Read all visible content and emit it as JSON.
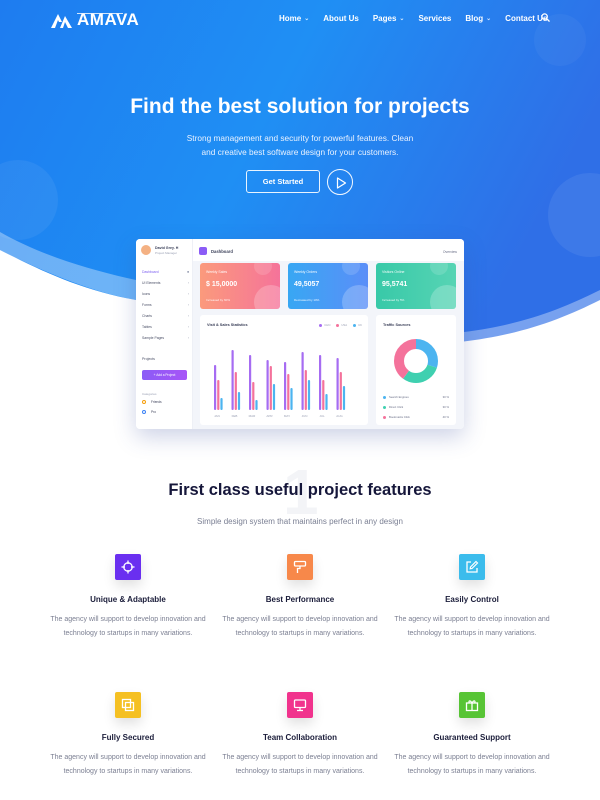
{
  "brand": {
    "name": "AMAVA"
  },
  "nav": {
    "items": [
      {
        "label": "Home",
        "caret": true
      },
      {
        "label": "About Us",
        "caret": false
      },
      {
        "label": "Pages",
        "caret": true
      },
      {
        "label": "Services",
        "caret": false
      },
      {
        "label": "Blog",
        "caret": true
      },
      {
        "label": "Contact Us",
        "caret": false
      }
    ],
    "search_icon": "search-icon"
  },
  "hero": {
    "title": "Find the best solution for projects",
    "subtitle": "Strong management and security for powerful features. Clean and creative best software design for your customers.",
    "cta_label": "Get Started",
    "play_icon": "play-icon"
  },
  "dashboard": {
    "user_name": "David Grey. H",
    "user_role": "Project Manager",
    "menu": [
      "Dashboard",
      "UI Elements",
      "Icons",
      "Forms",
      "Charts",
      "Tables",
      "Sample Pages"
    ],
    "projects_label": "Projects",
    "add_project_label": "+ Add a Project",
    "groups_label": "Categories",
    "options": [
      "Friends",
      "Pro"
    ],
    "header_title": "Dashboard",
    "overview_label": "Overview",
    "cards": [
      {
        "label": "Weekly Sales",
        "value": "$ 15,0000",
        "footer": "Increased by 60%"
      },
      {
        "label": "Weekly Orders",
        "value": "49,5057",
        "footer": "Decreased by 10%"
      },
      {
        "label": "Visitors Online",
        "value": "95,5741",
        "footer": "Increased by 5%"
      }
    ],
    "chart_title": "Visit & Sales Statistics",
    "chart_legend": [
      "CHN",
      "USA",
      "UK"
    ],
    "chart_months": [
      "JAN",
      "FEB",
      "MAR",
      "APR",
      "MAY",
      "JUN",
      "JUL",
      "AUG"
    ],
    "chart_series": [
      [
        45,
        60,
        55,
        50,
        48,
        58,
        55,
        52
      ],
      [
        30,
        38,
        28,
        44,
        36,
        40,
        30,
        38
      ],
      [
        12,
        18,
        10,
        26,
        22,
        30,
        16,
        24
      ]
    ],
    "traffic_title": "Traffic Sources",
    "traffic": [
      {
        "label": "Search Engines",
        "value": "30 %"
      },
      {
        "label": "Direct Click",
        "value": "30 %"
      },
      {
        "label": "Bookmarks Click",
        "value": "40 %"
      }
    ],
    "colors": {
      "purple": "#a66cf2",
      "pink": "#f4729b",
      "blue": "#4cb4f0",
      "teal": "#3fd0b0"
    }
  },
  "features": {
    "watermark": "1",
    "title": "First class useful project features",
    "subtitle": "Simple design system that maintains perfect in any design",
    "items": [
      {
        "name": "Unique & Adaptable",
        "desc": "The agency will support to develop innovation and technology to startups in many variations.",
        "icon": "target-icon",
        "color": "#6a2ff0"
      },
      {
        "name": "Best Performance",
        "desc": "The agency will support to develop innovation and technology to startups in many variations.",
        "icon": "paint-roller-icon",
        "color": "#f7884a"
      },
      {
        "name": "Easily Control",
        "desc": "The agency will support to develop innovation and technology to startups in many variations.",
        "icon": "edit-icon",
        "color": "#3bbcec"
      },
      {
        "name": "Fully Secured",
        "desc": "The agency will support to develop innovation and technology to startups in many variations.",
        "icon": "copy-icon",
        "color": "#f5c022"
      },
      {
        "name": "Team Collaboration",
        "desc": "The agency will support to develop innovation and technology to startups in many variations.",
        "icon": "monitor-icon",
        "color": "#f1338d"
      },
      {
        "name": "Guaranteed Support",
        "desc": "The agency will support to develop innovation and technology to startups in many variations.",
        "icon": "gift-icon",
        "color": "#57c435"
      }
    ]
  }
}
